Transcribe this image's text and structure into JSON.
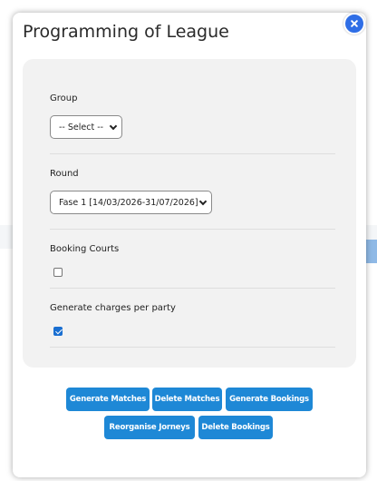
{
  "modal": {
    "title": "Programming of League"
  },
  "form": {
    "group": {
      "label": "Group",
      "selected": "-- Select --"
    },
    "round": {
      "label": "Round",
      "selected": "Fase 1 [14/03/2026-31/07/2026]"
    },
    "booking_courts": {
      "label": "Booking Courts",
      "checked": false
    },
    "generate_charges": {
      "label": "Generate charges per party",
      "checked": true
    }
  },
  "actions": {
    "generate_matches": "Generate Matches",
    "delete_matches": "Delete Matches",
    "generate_bookings": "Generate Bookings",
    "reorganise_jorneys": "Reorganise Jorneys",
    "delete_bookings": "Delete Bookings"
  },
  "colors": {
    "accent": "#1e88d6",
    "close": "#2f6ee6",
    "panel": "#f2f2f2"
  },
  "icons": {
    "close": "close-icon",
    "dropdown": "chevron-down-icon",
    "checkmark": "checkmark-icon"
  }
}
